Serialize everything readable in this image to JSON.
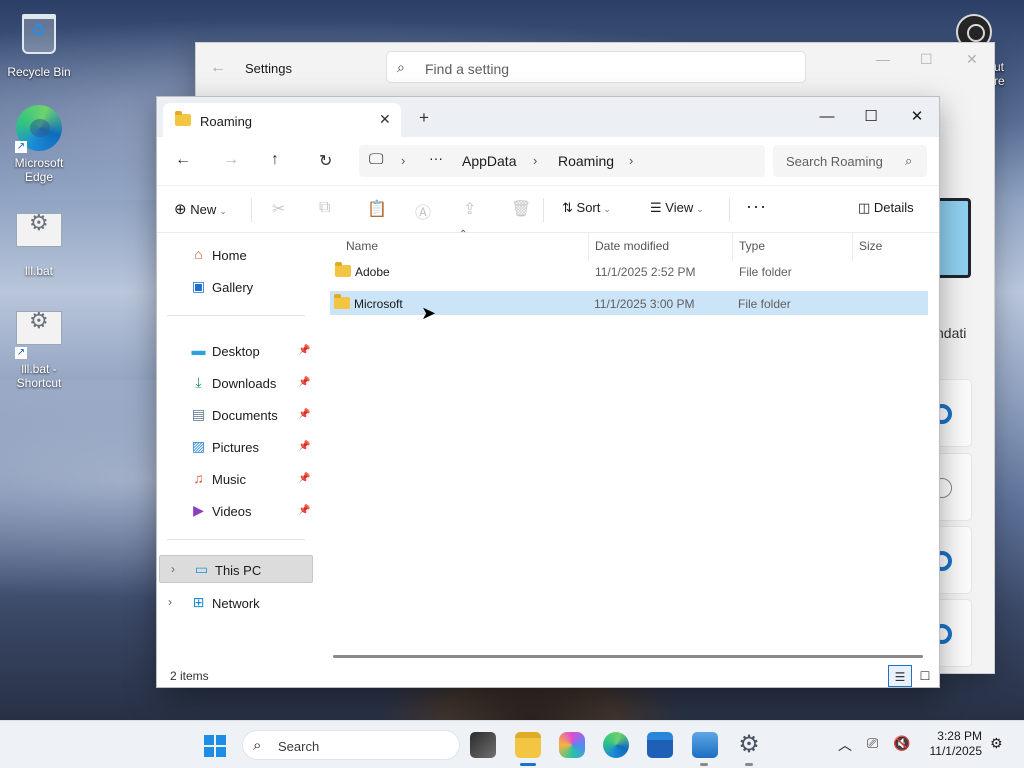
{
  "desktop": {
    "icons": [
      {
        "label": "Recycle Bin"
      },
      {
        "label": "Microsoft Edge"
      },
      {
        "label": "lll.bat"
      },
      {
        "label": "lll.bat - Shortcut"
      }
    ],
    "peek_text": "ut\nre"
  },
  "settings": {
    "title": "Settings",
    "search_placeholder": "Find a setting",
    "partial_text": "ndati"
  },
  "explorer": {
    "tab_title": "Roaming",
    "breadcrumb": [
      "AppData",
      "Roaming"
    ],
    "search_placeholder": "Search Roaming",
    "commands": {
      "new": "New",
      "sort": "Sort",
      "view": "View",
      "details": "Details"
    },
    "sidebar": {
      "top": [
        {
          "label": "Home",
          "icon": "home-icon"
        },
        {
          "label": "Gallery",
          "icon": "gallery-icon"
        }
      ],
      "pinned": [
        {
          "label": "Desktop",
          "icon": "desktop-icon"
        },
        {
          "label": "Downloads",
          "icon": "download-icon"
        },
        {
          "label": "Documents",
          "icon": "documents-icon"
        },
        {
          "label": "Pictures",
          "icon": "pictures-icon"
        },
        {
          "label": "Music",
          "icon": "music-icon"
        },
        {
          "label": "Videos",
          "icon": "videos-icon"
        }
      ],
      "drives": [
        {
          "label": "This PC",
          "icon": "pc-icon",
          "selected": true
        },
        {
          "label": "Network",
          "icon": "network-icon",
          "selected": false
        }
      ]
    },
    "columns": [
      "Name",
      "Date modified",
      "Type",
      "Size"
    ],
    "rows": [
      {
        "name": "Adobe",
        "date": "11/1/2025 2:52 PM",
        "type": "File folder",
        "size": ""
      },
      {
        "name": "Microsoft",
        "date": "11/1/2025 3:00 PM",
        "type": "File folder",
        "size": ""
      }
    ],
    "status": "2 items"
  },
  "taskbar": {
    "search_placeholder": "Search",
    "time": "3:28 PM",
    "date": "11/1/2025"
  },
  "colors": {
    "accent": "#1a73c8",
    "selection": "#cce4f7",
    "folder": "#f4c542"
  }
}
